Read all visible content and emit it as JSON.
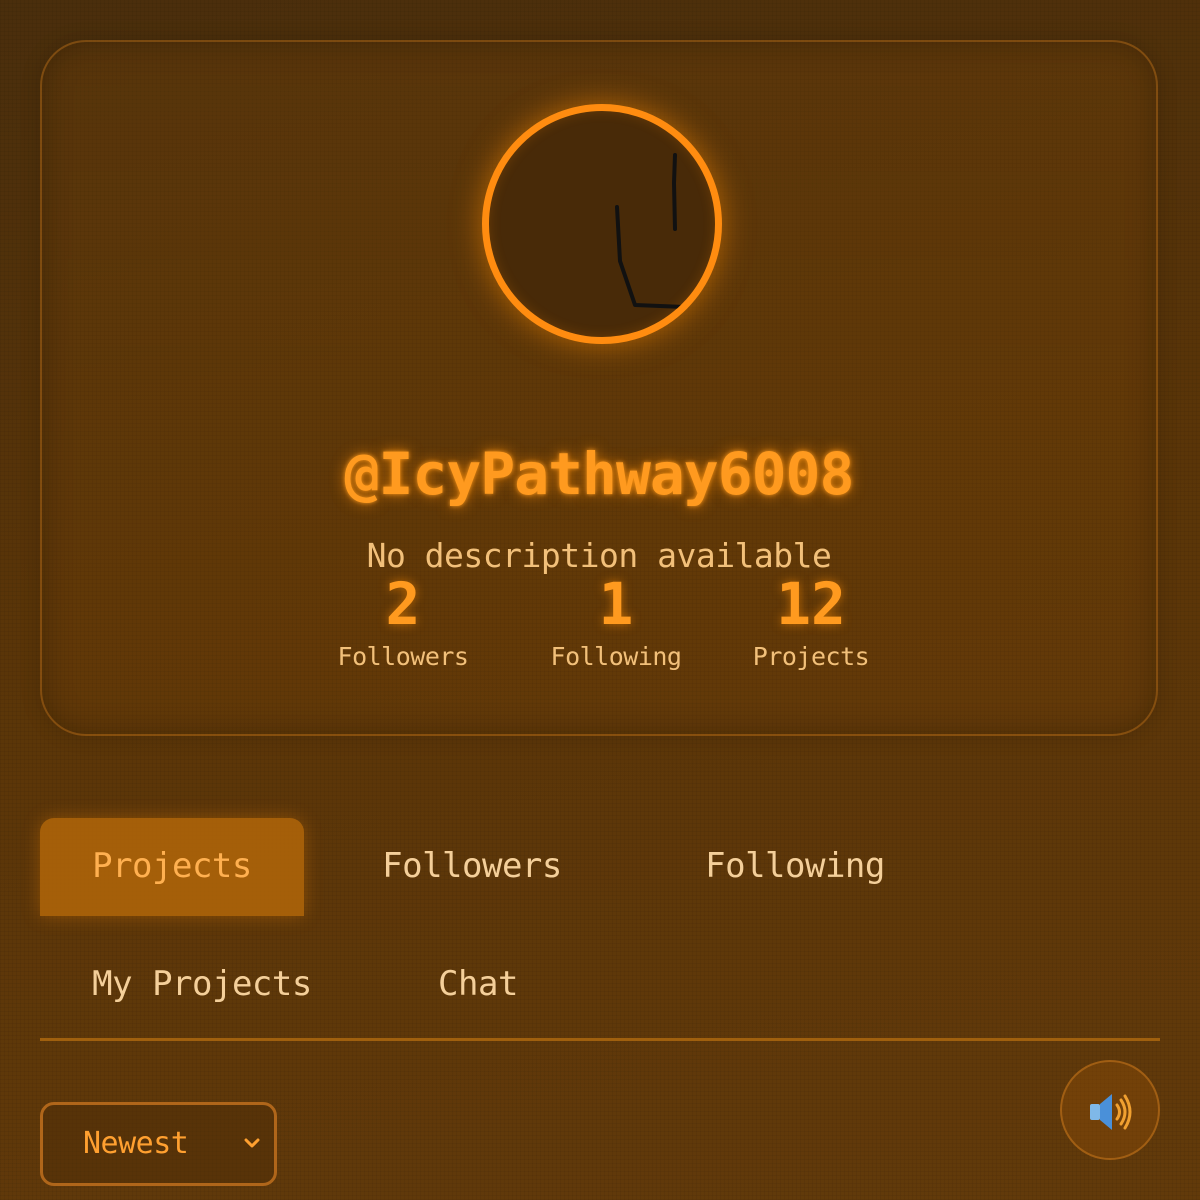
{
  "profile": {
    "username": "@IcyPathway6008",
    "description": "No description available",
    "avatar_icon": "hand-drawn-avatar",
    "stats": [
      {
        "value": "2",
        "label": "Followers"
      },
      {
        "value": "1",
        "label": "Following"
      },
      {
        "value": "12",
        "label": "Projects"
      }
    ]
  },
  "tabs": {
    "projects": "Projects",
    "followers": "Followers",
    "following": "Following",
    "my_projects": "My Projects",
    "chat": "Chat",
    "active": "Projects"
  },
  "sort": {
    "selected": "Newest",
    "icon": "chevron-down-icon"
  },
  "sound": {
    "icon": "speaker-icon"
  },
  "colors": {
    "accent": "#ff8c10",
    "background": "#5a3508",
    "text": "#f2c07a"
  }
}
